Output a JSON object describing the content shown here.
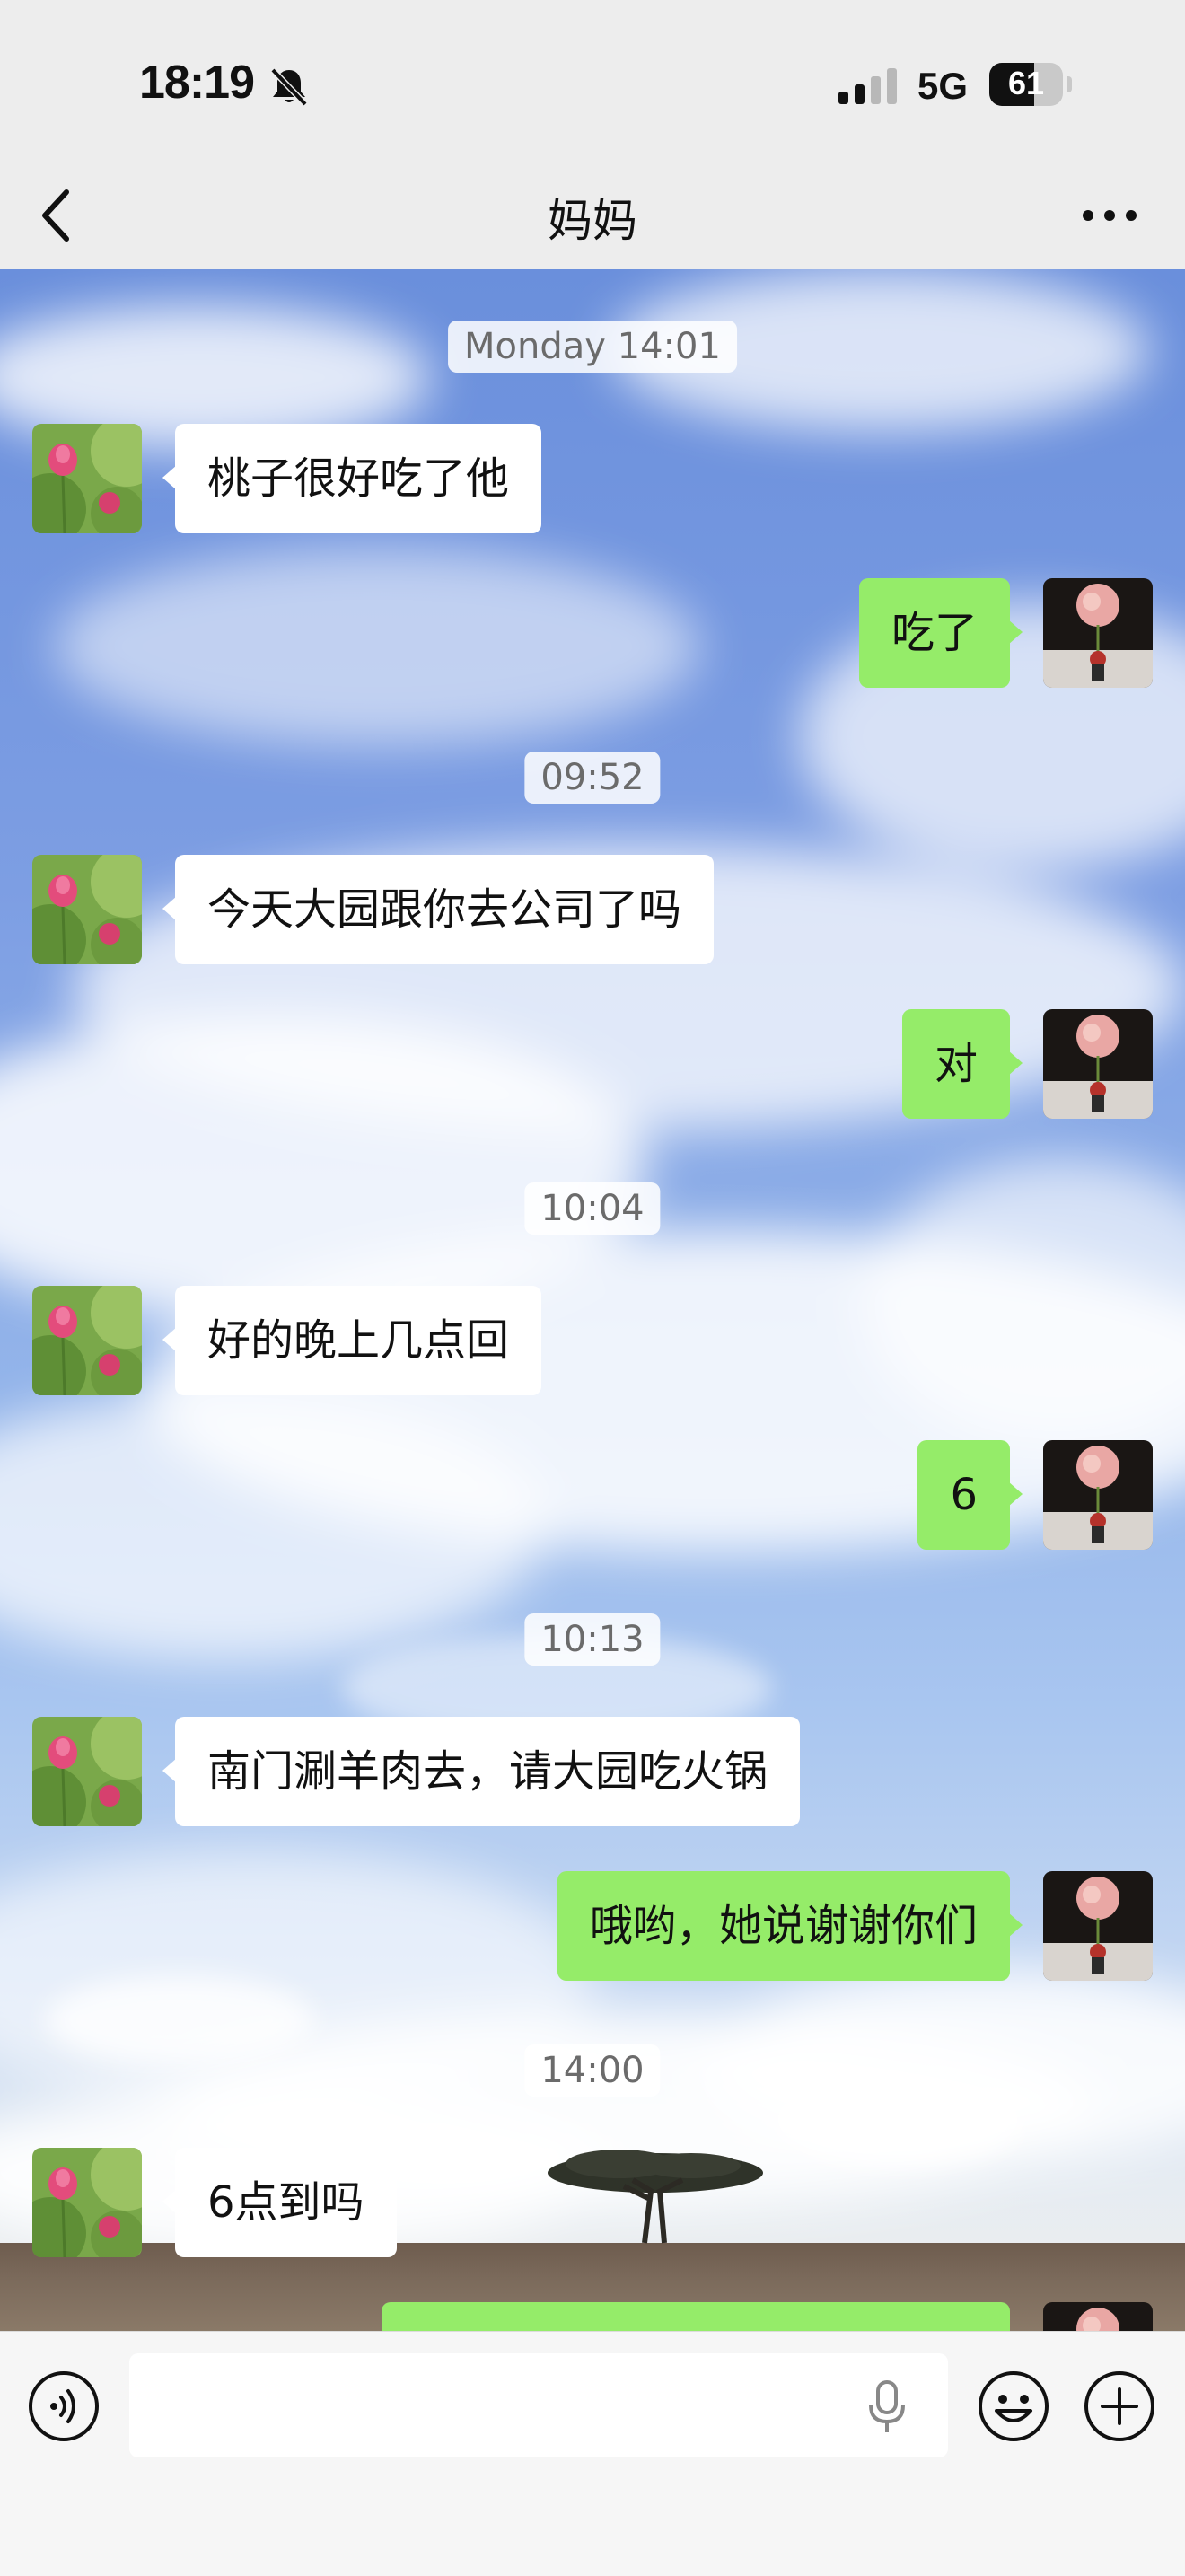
{
  "status_bar": {
    "time": "18:19",
    "network": "5G",
    "battery_percent": "61",
    "battery_level": 0.61,
    "icons": [
      "bell-muted-icon",
      "signal-icon",
      "battery-icon"
    ]
  },
  "nav": {
    "title": "妈妈",
    "back_icon": "chevron-left-icon",
    "more_icon": "more-dots-icon"
  },
  "conversation": {
    "timestamps": [
      "Monday 14:01",
      "09:52",
      "10:04",
      "10:13",
      "14:00"
    ],
    "messages": [
      {
        "side": "left",
        "text": "桃子很好吃了他"
      },
      {
        "side": "right",
        "text": "吃了"
      },
      {
        "side": "left",
        "text": "今天大园跟你去公司了吗"
      },
      {
        "side": "right",
        "text": "对"
      },
      {
        "side": "left",
        "text": "好的晚上几点回"
      },
      {
        "side": "right",
        "text": "6"
      },
      {
        "side": "left",
        "text": "南门涮羊肉去，请大园吃火锅"
      },
      {
        "side": "right",
        "text": "哦哟，她说谢谢你们"
      },
      {
        "side": "left",
        "text": "6点到吗"
      }
    ]
  },
  "input_bar": {
    "placeholder": "",
    "icons": [
      "voice-icon",
      "mic-icon",
      "emoji-icon",
      "plus-icon"
    ]
  },
  "colors": {
    "sent_bubble": "#95ec69",
    "received_bubble": "#ffffff",
    "bar_background": "#ededed"
  }
}
